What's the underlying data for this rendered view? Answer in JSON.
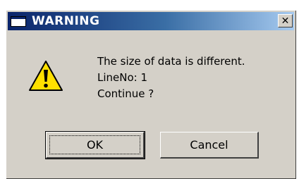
{
  "window": {
    "title": "WARNING",
    "close_glyph": "✕"
  },
  "message": {
    "line1": "The size of data is different.",
    "line2": "LineNo: 1",
    "line3": "Continue ?",
    "icon": "warning-triangle-icon"
  },
  "buttons": {
    "ok_label": "OK",
    "cancel_label": "Cancel"
  },
  "colors": {
    "title_bar": "#0a246a",
    "dialog_bg": "#d4d0c8",
    "warning_yellow": "#ffe000"
  }
}
